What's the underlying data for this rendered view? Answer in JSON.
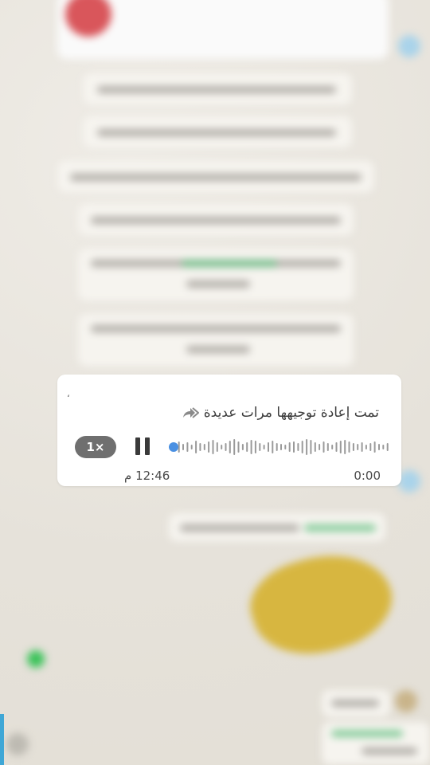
{
  "voice_message": {
    "forwarded_label": "تمت إعادة توجيهها مرات عديدة",
    "speed_label": "1×",
    "sent_time": "12:46 م",
    "duration": "0:00",
    "progress": 0,
    "corner_mark": "،"
  },
  "colors": {
    "playhead": "#4a90e2",
    "waveform": "#9a9a9a",
    "bubble": "#ffffff",
    "speed_button": "#6f6f6f"
  },
  "icons": {
    "forward": "double-forward-arrow-icon",
    "pause": "pause-icon"
  }
}
